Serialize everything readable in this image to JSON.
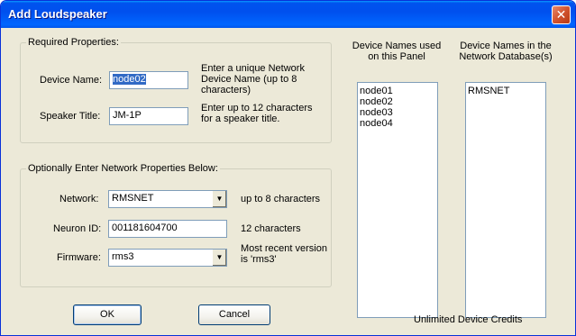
{
  "window": {
    "title": "Add Loudspeaker",
    "close_glyph": "✕"
  },
  "required": {
    "legend": "Required Properties:",
    "device_name_label": "Device Name:",
    "device_name_value": "node02",
    "device_name_hint": "Enter  a unique Network Device  Name (up to 8 characters)",
    "speaker_title_label": "Speaker Title:",
    "speaker_title_value": "JM-1P",
    "speaker_title_hint": "Enter up to 12 characters for a speaker title."
  },
  "optional": {
    "legend": "Optionally Enter Network Properties Below:",
    "network_label": "Network:",
    "network_value": "RMSNET",
    "network_hint": "up to 8 characters",
    "neuron_label": "Neuron ID:",
    "neuron_value": "001181604700",
    "neuron_hint": "12 characters",
    "firmware_label": "Firmware:",
    "firmware_value": "rms3",
    "firmware_hint": "Most recent version is 'rms3'"
  },
  "panel_devices": {
    "header": "Device Names used on this Panel",
    "items": [
      "node01",
      "node02",
      "node03",
      "node04"
    ]
  },
  "network_devices": {
    "header": "Device Names in the Network Database(s)",
    "items": [
      "RMSNET"
    ]
  },
  "buttons": {
    "ok": "OK",
    "cancel": "Cancel"
  },
  "status": {
    "credits": "Unlimited Device Credits"
  },
  "colors": {
    "titlebar": "#0054e3",
    "face": "#ece9d8",
    "selection": "#316ac5"
  }
}
